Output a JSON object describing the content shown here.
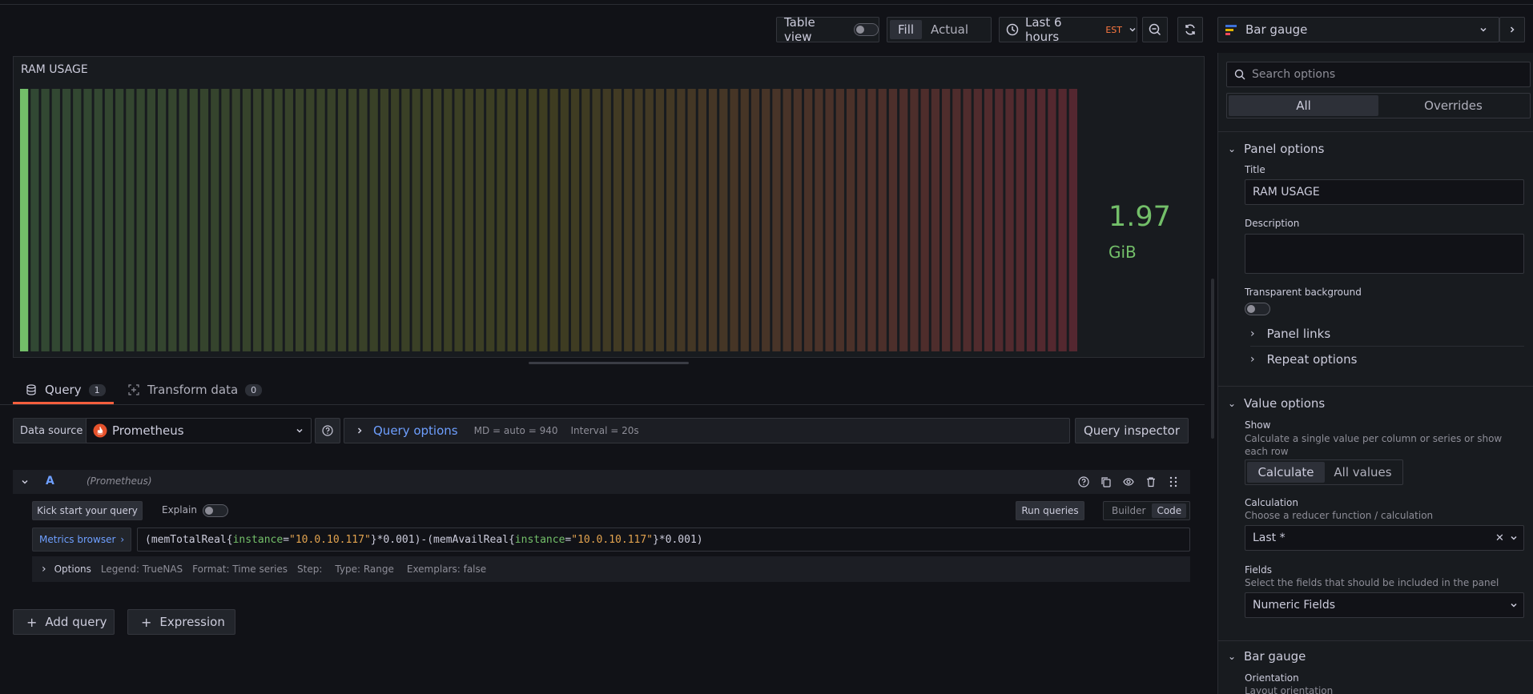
{
  "toolbar": {
    "table_view_label": "Table view",
    "fill_label": "Fill",
    "actual_label": "Actual",
    "time_range": "Last 6 hours",
    "timezone": "EST",
    "visualization": "Bar gauge"
  },
  "panel": {
    "title": "RAM USAGE",
    "value": "1.97",
    "unit": "GiB",
    "bar_count": 100,
    "filled_fraction": 0.006,
    "gradient_colors": [
      "#73bf69",
      "#e0b400",
      "#f2495c"
    ]
  },
  "tabs": [
    {
      "label": "Query",
      "count": "1"
    },
    {
      "label": "Transform data",
      "count": "0"
    }
  ],
  "datasource": {
    "label": "Data source",
    "name": "Prometheus",
    "query_options_label": "Query options",
    "md": "MD = auto = 940",
    "interval": "Interval = 20s",
    "inspector_label": "Query inspector"
  },
  "query": {
    "ref": "A",
    "source": "(Prometheus)",
    "kickstart_label": "Kick start your query",
    "explain_label": "Explain",
    "run_label": "Run queries",
    "builder_label": "Builder",
    "code_label": "Code",
    "metrics_browser_label": "Metrics browser",
    "expr": {
      "p1": "(memTotalReal{",
      "p2": "instance",
      "p3": "=",
      "p4": "\"10.0.10.117\"",
      "p5": "}*0.001)-(memAvailReal{",
      "p6": "instance",
      "p7": "=",
      "p8": "\"10.0.10.117\"",
      "p9": "}*0.001)"
    },
    "options": {
      "label": "Options",
      "legend": "Legend: TrueNAS",
      "format": "Format: Time series",
      "step": "Step:",
      "type": "Type: Range",
      "exemplars": "Exemplars: false"
    },
    "add_query_label": "Add query",
    "expression_label": "Expression"
  },
  "options_pane": {
    "search_placeholder": "Search options",
    "all_tab": "All",
    "overrides_tab": "Overrides",
    "panel_options": {
      "title": "Panel options",
      "title_label": "Title",
      "title_value": "RAM USAGE",
      "description_label": "Description",
      "transparent_label": "Transparent background",
      "panel_links": "Panel links",
      "repeat_options": "Repeat options"
    },
    "value_options": {
      "title": "Value options",
      "show_label": "Show",
      "show_desc": "Calculate a single value per column or series or show each row",
      "calculate": "Calculate",
      "all_values": "All values",
      "calculation_label": "Calculation",
      "calculation_desc": "Choose a reducer function / calculation",
      "calculation_value": "Last *",
      "fields_label": "Fields",
      "fields_desc": "Select the fields that should be included in the panel",
      "fields_value": "Numeric Fields"
    },
    "bar_gauge": {
      "title": "Bar gauge",
      "orientation_label": "Orientation",
      "orientation_desc": "Layout orientation"
    }
  }
}
